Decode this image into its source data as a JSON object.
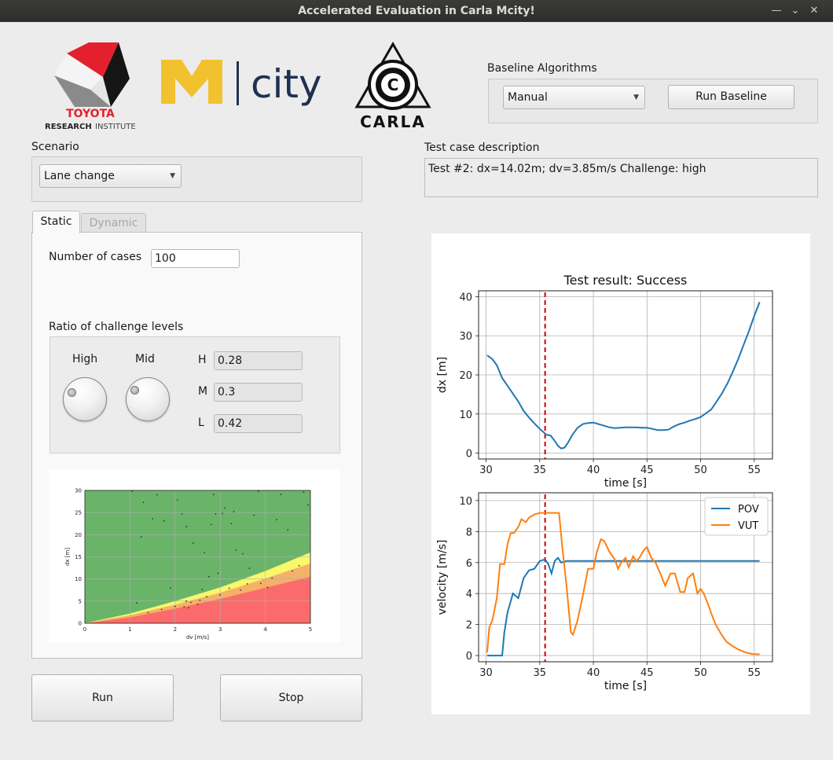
{
  "window": {
    "title": "Accelerated Evaluation in Carla Mcity!",
    "min_glyph": "—",
    "restore_glyph": "⌄",
    "close_glyph": "✕"
  },
  "logos": {
    "toyota_line1": "TOYOTA",
    "toyota_line2_a": "RESEARCH",
    "toyota_line2_b": "INSTITUTE",
    "mcity_m": "M",
    "mcity_word": "city",
    "carla_word": "CARLA",
    "carla_c": "C"
  },
  "baseline": {
    "label": "Baseline Algorithms",
    "selected": "Manual",
    "run_label": "Run Baseline"
  },
  "scenario": {
    "label": "Scenario",
    "selected": "Lane change"
  },
  "test_case": {
    "label": "Test case description",
    "text": "Test #2:  dx=14.02m;  dv=3.85m/s Challenge: high"
  },
  "tabs": {
    "static": "Static",
    "dynamic": "Dynamic"
  },
  "static_panel": {
    "num_cases_label": "Number of cases",
    "num_cases_value": "100",
    "ratio_label": "Ratio of challenge levels",
    "high_label": "High",
    "mid_label": "Mid",
    "h_label": "H",
    "m_label": "M",
    "l_label": "L",
    "h_value": "0.28",
    "m_value": "0.3",
    "l_value": "0.42"
  },
  "buttons": {
    "run": "Run",
    "stop": "Stop"
  },
  "colors": {
    "green": "#6ab46a",
    "yellow": "#f9f76a",
    "orange": "#f5b167",
    "red": "#fc6b6b",
    "pov": "#1f77b4",
    "vut": "#ff7f0e",
    "marker": "#cc0000",
    "toyota_red": "#e5202e",
    "mcity_gold": "#f2c12e",
    "mcity_navy": "#1f3152"
  },
  "chart_data": [
    {
      "type": "area",
      "xlabel": "dv [m/s]",
      "ylabel": "dx [m]",
      "xlim": [
        0,
        5
      ],
      "ylim": [
        0,
        30
      ],
      "xticks": [
        "0",
        "1",
        "2",
        "3",
        "4",
        "5"
      ],
      "yticks": [
        "0",
        "5",
        "10",
        "15",
        "20",
        "25",
        "30"
      ],
      "grid": true,
      "regions": [
        {
          "name": "L",
          "color": "green"
        },
        {
          "name": "M",
          "color": "yellow"
        },
        {
          "name": "H",
          "color": "red"
        }
      ],
      "boundary_yellow": {
        "x": [
          0,
          1,
          2,
          3,
          4,
          5
        ],
        "y": [
          0,
          2.2,
          5,
          8.1,
          11.8,
          16
        ]
      },
      "boundary_orange": {
        "x": [
          0,
          1,
          2,
          3,
          4,
          5
        ],
        "y": [
          0,
          1.8,
          4.2,
          6.9,
          10.1,
          13.5
        ]
      },
      "boundary_red": {
        "x": [
          0,
          1,
          2,
          3,
          4,
          5
        ],
        "y": [
          0,
          1.3,
          3.3,
          5.5,
          8,
          10.5
        ]
      },
      "scatter": {
        "x": [
          1.05,
          1.3,
          1.25,
          1.5,
          1.6,
          1.75,
          1.9,
          2.05,
          2.15,
          2.2,
          2.25,
          2.3,
          2.4,
          2.5,
          2.65,
          2.7,
          2.75,
          2.8,
          2.85,
          2.9,
          3.05,
          3.1,
          3.2,
          3.25,
          3.3,
          3.35,
          3.5,
          3.6,
          3.75,
          3.85,
          4.05,
          4.25,
          4.35,
          4.5,
          4.75,
          4.85,
          4.95,
          1.4,
          1.7,
          2.0,
          2.35,
          2.55,
          3.0,
          3.45,
          3.9,
          4.15,
          4.6,
          1.15,
          2.95,
          3.65,
          2.25,
          2.6
        ],
        "y": [
          29.8,
          27.3,
          19.5,
          23.6,
          29.0,
          23.1,
          8.0,
          27.8,
          24.7,
          3.7,
          21.8,
          3.5,
          18.1,
          4.3,
          16.0,
          6.0,
          10.5,
          22.3,
          29.1,
          24.7,
          24.8,
          26.0,
          7.9,
          22.5,
          25.2,
          16.5,
          15.7,
          8.9,
          24.4,
          29.8,
          8.1,
          23.4,
          29.1,
          21.1,
          13.0,
          29.6,
          26.7,
          2.4,
          3.1,
          3.8,
          4.7,
          5.2,
          6.4,
          7.5,
          9.0,
          10.2,
          11.8,
          4.6,
          11.3,
          12.4,
          5.0,
          7.6
        ]
      }
    },
    {
      "type": "line",
      "title": "Test result: Success",
      "xlabel": "time [s]",
      "ylabel": "dx [m]",
      "xlim": [
        29.3,
        56.7
      ],
      "ylim": [
        -1.5,
        41.5
      ],
      "xticks": [
        30,
        35,
        40,
        45,
        50,
        55
      ],
      "yticks": [
        0,
        10,
        20,
        30,
        40
      ],
      "grid": true,
      "marker_x": 35.5,
      "series": [
        {
          "x": [
            30.1,
            30.6,
            31.0,
            31.5,
            32.0,
            32.5,
            33.0,
            33.5,
            34.0,
            34.5,
            35.0,
            35.3,
            35.6,
            36.0,
            36.3,
            36.7,
            37.0,
            37.3,
            37.6,
            38.0,
            38.5,
            39.0,
            39.5,
            40.0,
            40.5,
            41.0,
            41.5,
            42.0,
            42.5,
            43.0,
            43.5,
            44.0,
            44.5,
            45.0,
            45.5,
            46.0,
            46.5,
            47.0,
            47.5,
            48.0,
            48.5,
            49.0,
            49.5,
            50.0,
            50.5,
            51.0,
            51.5,
            52.0,
            52.5,
            53.0,
            53.5,
            54.0,
            54.5,
            55.0,
            55.5
          ],
          "y": [
            25,
            24,
            22.5,
            19.2,
            17.2,
            15.2,
            13.2,
            10.8,
            9.1,
            7.6,
            6.2,
            5.5,
            4.7,
            4.5,
            3.5,
            1.9,
            1.2,
            1.4,
            2.5,
            4.5,
            6.4,
            7.4,
            7.7,
            7.8,
            7.4,
            7.0,
            6.6,
            6.4,
            6.5,
            6.6,
            6.6,
            6.6,
            6.5,
            6.5,
            6.2,
            5.9,
            5.9,
            6.0,
            6.8,
            7.4,
            7.8,
            8.3,
            8.7,
            9.2,
            10.2,
            11.2,
            13.2,
            15.3,
            17.8,
            20.8,
            24.0,
            27.6,
            31.2,
            35.1,
            38.6
          ]
        }
      ]
    },
    {
      "type": "line",
      "xlabel": "time [s]",
      "ylabel": "velocity [m/s]",
      "xlim": [
        29.3,
        56.7
      ],
      "ylim": [
        -0.4,
        10.5
      ],
      "xticks": [
        30,
        35,
        40,
        45,
        50,
        55
      ],
      "yticks": [
        0,
        2,
        4,
        6,
        8,
        10
      ],
      "grid": true,
      "legend": "top-right",
      "marker_x": 35.5,
      "series": [
        {
          "name": "POV",
          "color": "pov",
          "x": [
            30.1,
            31.5,
            31.7,
            32.0,
            32.5,
            33.0,
            33.5,
            34.0,
            34.5,
            35.0,
            35.5,
            35.8,
            36.1,
            36.4,
            36.7,
            37.0,
            37.5,
            38.0,
            39.0,
            40.0,
            45.0,
            50.0,
            55.5
          ],
          "y": [
            0,
            0,
            1.5,
            2.8,
            4.0,
            3.7,
            5.0,
            5.5,
            5.6,
            6.1,
            6.2,
            5.9,
            5.3,
            6.1,
            6.3,
            6.0,
            6.1,
            6.1,
            6.1,
            6.1,
            6.1,
            6.1,
            6.1
          ]
        },
        {
          "name": "VUT",
          "color": "vut",
          "x": [
            30.1,
            30.3,
            30.6,
            31.0,
            31.3,
            31.7,
            32.0,
            32.3,
            32.6,
            33.0,
            33.3,
            33.7,
            34.0,
            34.5,
            35.0,
            35.5,
            36.0,
            36.5,
            36.8,
            37.1,
            37.5,
            37.9,
            38.1,
            38.5,
            39.0,
            39.5,
            40.0,
            40.3,
            40.7,
            41.0,
            41.5,
            42.0,
            42.3,
            42.6,
            43.0,
            43.3,
            43.7,
            44.0,
            44.3,
            44.7,
            45.0,
            45.4,
            45.8,
            46.3,
            46.7,
            47.2,
            47.6,
            48.1,
            48.5,
            48.8,
            49.3,
            49.7,
            50.0,
            50.3,
            50.7,
            51.0,
            51.4,
            51.9,
            52.4,
            53.0,
            53.5,
            54.2,
            54.8,
            55.5
          ],
          "y": [
            0.2,
            1.8,
            2.3,
            3.7,
            5.9,
            5.9,
            7.2,
            7.9,
            7.9,
            8.3,
            8.8,
            8.6,
            8.9,
            9.1,
            9.2,
            9.2,
            9.2,
            9.2,
            9.2,
            7.0,
            4.5,
            1.5,
            1.35,
            2.2,
            3.8,
            5.6,
            5.6,
            6.6,
            7.5,
            7.4,
            6.7,
            6.2,
            5.6,
            6.0,
            6.3,
            5.7,
            6.4,
            6.1,
            6.3,
            6.8,
            7.0,
            6.3,
            6.0,
            5.2,
            4.5,
            5.3,
            5.3,
            4.1,
            4.1,
            5.0,
            5.3,
            4.0,
            4.3,
            4.0,
            3.3,
            2.7,
            2.0,
            1.4,
            0.9,
            0.6,
            0.4,
            0.2,
            0.1,
            0.08
          ]
        }
      ]
    }
  ]
}
